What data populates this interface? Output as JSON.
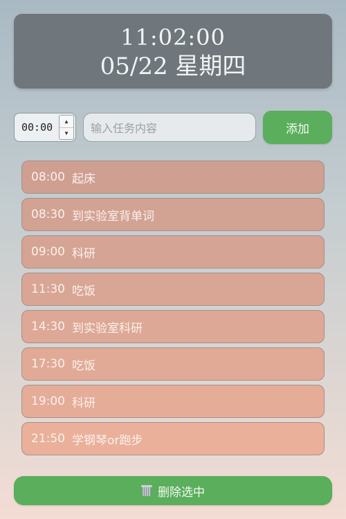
{
  "clock": {
    "time": "11:02:00",
    "date": "05/22 星期四"
  },
  "form": {
    "time_value": "00:00",
    "task_placeholder": "输入任务内容",
    "add_label": "添加"
  },
  "tasks": [
    {
      "time": "08:00",
      "text": "起床",
      "color": "#cf9f92"
    },
    {
      "time": "08:30",
      "text": "到实验室背单词",
      "color": "#d2a293"
    },
    {
      "time": "09:00",
      "text": "科研",
      "color": "#d6a494"
    },
    {
      "time": "11:30",
      "text": "吃饭",
      "color": "#d9a695"
    },
    {
      "time": "14:30",
      "text": "到实验室科研",
      "color": "#dda896"
    },
    {
      "time": "17:30",
      "text": "吃饭",
      "color": "#e1aa97"
    },
    {
      "time": "19:00",
      "text": "科研",
      "color": "#e5ac98"
    },
    {
      "time": "21:50",
      "text": "学钢琴or跑步",
      "color": "#eab099"
    }
  ],
  "footer": {
    "delete_label": "删除选中",
    "delete_icon": "trash-icon"
  },
  "colors": {
    "clock_bg": "#6f777c",
    "accent_green": "#5aae5c"
  }
}
